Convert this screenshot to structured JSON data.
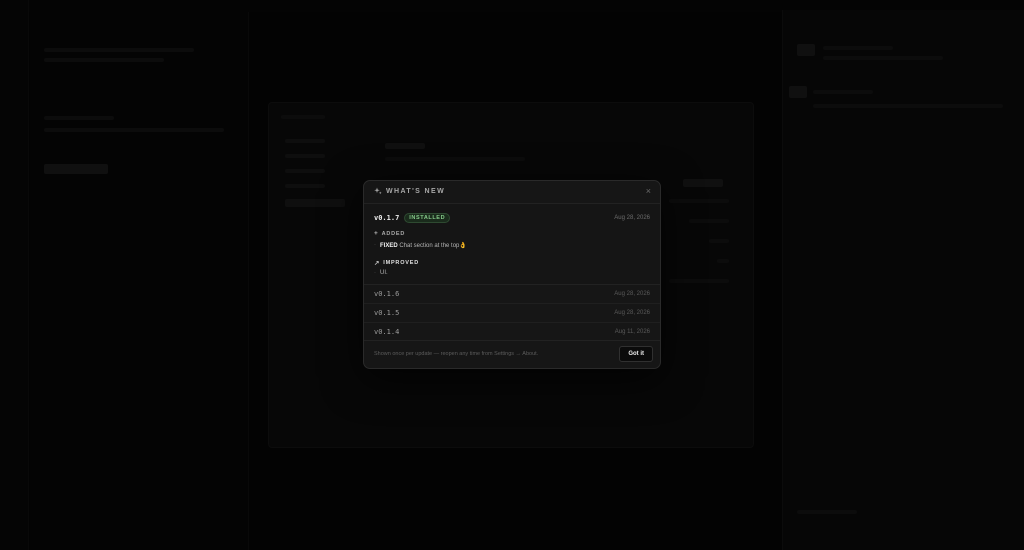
{
  "modal": {
    "title": "WHAT'S NEW",
    "close_glyph": "×",
    "latest": {
      "version": "v0.1.7",
      "badge": "INSTALLED",
      "date": "Aug 28, 2026",
      "sections": [
        {
          "icon": "plus-icon",
          "glyph": "+",
          "heading": "ADDED",
          "items": [
            {
              "bold": "FIXED",
              "text": " Chat section at the top👌"
            }
          ]
        },
        {
          "icon": "arrow-up-right-icon",
          "glyph": "↗",
          "heading": "IMPROVED",
          "items": [
            {
              "bold": "",
              "text": "UI."
            }
          ]
        }
      ]
    },
    "older": [
      {
        "version": "v0.1.6",
        "date": "Aug 28, 2026"
      },
      {
        "version": "v0.1.5",
        "date": "Aug 28, 2026"
      },
      {
        "version": "v0.1.4",
        "date": "Aug 11, 2026"
      }
    ],
    "footer_note": "Shown once per update — reopen any time from Settings → About.",
    "confirm_label": "Got it"
  },
  "colors": {
    "accent_green": "#86c98a",
    "modal_bg": "#161616",
    "page_bg": "#060606"
  }
}
